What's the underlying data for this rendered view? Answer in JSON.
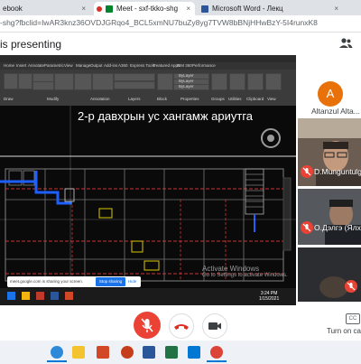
{
  "browser": {
    "tabs": [
      {
        "label": "ebook",
        "close": "×"
      },
      {
        "label": "Meet - sxf-tkko-shg",
        "close": "×"
      },
      {
        "label": "Microsoft Word - Лекц",
        "close": "×"
      }
    ],
    "url": "-shg?fbclid=IwAR3knz36OVDJGRqo4_BCL5xmNU7buZy8yg7TVW8bBNjHHwBzY-5I4runxK8"
  },
  "meet": {
    "presenting": "is presenting",
    "participants": [
      {
        "initial": "A",
        "name": "Altanzul Alta...",
        "muted": false
      },
      {
        "name": "D.Munguntulga...",
        "muted": true
      },
      {
        "name": "O.Дэлгэ (Ялх...",
        "muted": true
      },
      {
        "name": "",
        "muted": true
      }
    ],
    "captions_label": "Turn on cap",
    "cc_label": "CC"
  },
  "shared_screen": {
    "heading": "2-р давхрын ус хангамж ариутга",
    "ribbon_tabs": [
      "Home",
      "Insert",
      "Annotate",
      "Parametric",
      "View",
      "Manage",
      "Output",
      "Add-ins",
      "A360",
      "Express Tools",
      "Featured Apps",
      "BIM 360",
      "Performance"
    ],
    "ribbon_groups": [
      "Draw",
      "Modify",
      "Annotation",
      "Layers",
      "Block",
      "Properties",
      "Groups",
      "Utilities",
      "Clipboard",
      "View"
    ],
    "props": [
      "ByLayer",
      "ByLayer",
      "ByLayer"
    ],
    "sharing_text": "meet.google.com is sharing your screen.",
    "stop_sharing": "Stop sharing",
    "hide": "Hide",
    "activate_title": "Activate Windows",
    "activate_sub": "Go to Settings to activate Windows.",
    "clock_time": "3:24 PM",
    "clock_date": "1/15/2021"
  },
  "colors": {
    "mic_off": "#ea4335",
    "avatar": "#e8710a",
    "accent": "#1a73e8"
  }
}
